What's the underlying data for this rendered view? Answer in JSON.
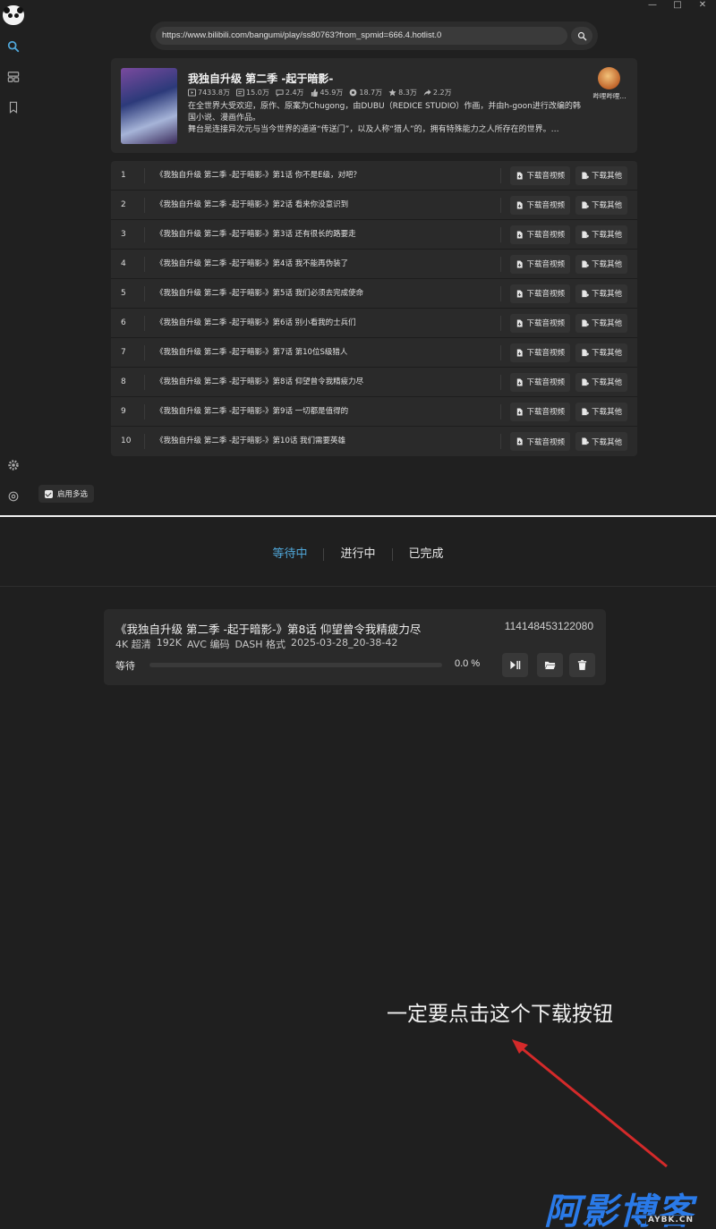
{
  "window": {
    "controls": {
      "minimize": "—",
      "maximize": "□",
      "close": "✕"
    }
  },
  "sidebar": {
    "icons": [
      "panda-logo",
      "search-icon",
      "layout-icon",
      "bookmark-icon",
      "gear-icon",
      "settings-icon"
    ],
    "accent": "#4fa6d8"
  },
  "search": {
    "url": "https://www.bilibili.com/bangumi/play/ss80763?from_spmid=666.4.hotlist.0"
  },
  "info": {
    "title": "我独自升级 第二季 -起于暗影-",
    "stats": {
      "views": "7433.8万",
      "danmaku": "15.0万",
      "replies": "2.4万",
      "likes": "45.9万",
      "coins": "18.7万",
      "favorites": "8.3万",
      "shares": "2.2万"
    },
    "description_line1": "在全世界大受欢迎，原作、原案为Chugong，由DUBU（REDICE STUDIO）作画，并由h-goon进行改编的韩",
    "description_line2": "国小说、漫画作品。",
    "description_line3": "舞台是连接异次元与当今世界的通道“传送门”，以及人称“猎人”的，拥有特殊能力之人所存在的世界。…",
    "uploader": "哔哩哔哩..."
  },
  "episodes": [
    {
      "num": "1",
      "title": "《我独自升级 第二季 -起于暗影-》第1话 你不是E级，对吧？"
    },
    {
      "num": "2",
      "title": "《我独自升级 第二季 -起于暗影-》第2话 看来你没意识到"
    },
    {
      "num": "3",
      "title": "《我独自升级 第二季 -起于暗影-》第3话 还有很长的路要走"
    },
    {
      "num": "4",
      "title": "《我独自升级 第二季 -起于暗影-》第4话 我不能再伪装了"
    },
    {
      "num": "5",
      "title": "《我独自升级 第二季 -起于暗影-》第5话 我们必须去完成使命"
    },
    {
      "num": "6",
      "title": "《我独自升级 第二季 -起于暗影-》第6话 别小看我的士兵们"
    },
    {
      "num": "7",
      "title": "《我独自升级 第二季 -起于暗影-》第7话 第10位S级猎人"
    },
    {
      "num": "8",
      "title": "《我独自升级 第二季 -起于暗影-》第8话 仰望曾令我精疲力尽"
    },
    {
      "num": "9",
      "title": "《我独自升级 第二季 -起于暗影-》第9话 一切都是值得的"
    },
    {
      "num": "10",
      "title": "《我独自升级 第二季 -起于暗影-》第10话 我们需要英雄"
    }
  ],
  "episode_buttons": {
    "download_av": "下载音视频",
    "download_other": "下载其他"
  },
  "multi_select": "启用多选",
  "tabs": [
    "等待中",
    "进行中",
    "已完成"
  ],
  "task": {
    "title": "《我独自升级 第二季 -起于暗影-》第8话 仰望曾令我精疲力尽",
    "id": "114148453122080",
    "quality": "4K 超清",
    "bitrate": "192K",
    "codec": "AVC 编码",
    "format": "DASH 格式",
    "time": "2025-03-28_20-38-42",
    "status": "等待",
    "progress": 0.0,
    "progress_text": "0.0 %"
  },
  "annotation": "一定要点击这个下载按钮",
  "watermark": {
    "main": "阿影博客",
    "sub": "AYBK.CN"
  }
}
